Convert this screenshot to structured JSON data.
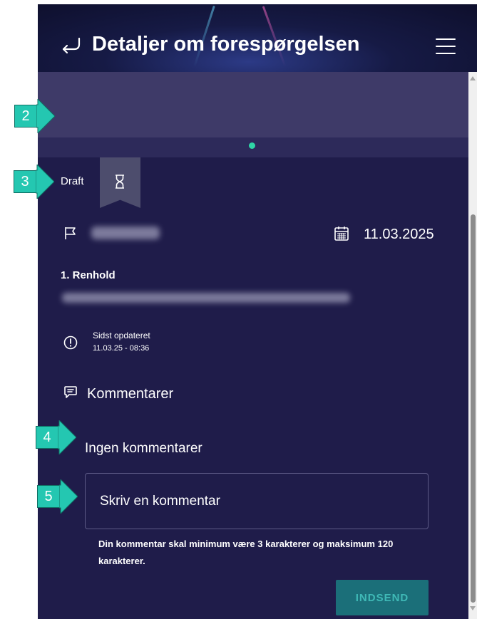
{
  "header": {
    "title": "Detaljer om forespørgelsen"
  },
  "request": {
    "status": "Draft",
    "date": "11.03.2025",
    "section": "1. Renhold",
    "updated_label": "Sidst opdateret",
    "updated_time": "11.03.25 - 08:36"
  },
  "comments": {
    "heading": "Kommentarer",
    "empty_text": "Ingen kommentarer",
    "input_placeholder": "Skriv en kommentar",
    "hint": "Din kommentar skal minimum være 3 karakterer og maksimum 120 karakterer.",
    "submit_label": "INDSEND"
  },
  "callouts": [
    "2",
    "3",
    "4",
    "5"
  ],
  "colors": {
    "background": "#1f1c4a",
    "accent": "#24c7b1",
    "button": "#1b6f79"
  }
}
